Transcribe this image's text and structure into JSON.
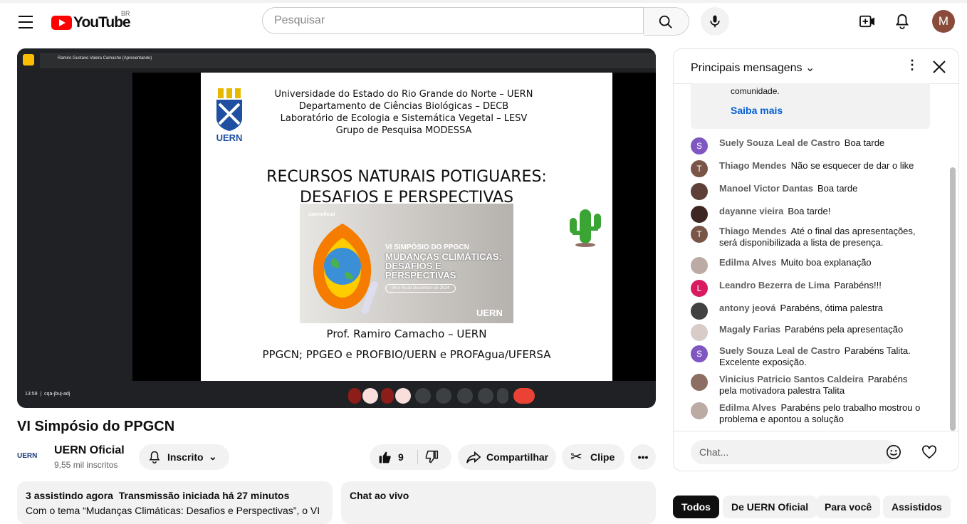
{
  "header": {
    "logo_text": "YouTube",
    "region": "BR",
    "search_placeholder": "Pesquisar",
    "avatar_letter": "M"
  },
  "player": {
    "meet_presenter": "Ramiro Gustavo Valera Camacho (Apresentando)",
    "clock": "13:59",
    "meeting_code": "cqa-jbuj-adj",
    "slide": {
      "header_lines": [
        "Universidade do Estado do Rio Grande do Norte – UERN",
        "Departamento de Ciências Biológicas – DECB",
        "Laboratório de Ecologia e Sistemática Vegetal – LESV",
        "Grupo de Pesquisa MODESSA"
      ],
      "logo_text": "UERN",
      "title_line1": "RECURSOS NATURAIS POTIGUARES:",
      "title_line2": "DESAFIOS E PERSPECTIVAS",
      "poster": {
        "handle": "/uernoficial",
        "event": "VI SIMPÓSIO DO PPGCN",
        "headline": "MUDANÇAS CLIMÁTICAS: DESAFIOS E PERSPECTIVAS",
        "dates": "04 e 05 de Dezembro de 2024",
        "brand": "UERN"
      },
      "presenter": "Prof. Ramiro Camacho – UERN",
      "programs": "PPGCN; PPGEO e PROFBIO/UERN e PROFAgua/UFERSA"
    }
  },
  "video": {
    "title": "VI Simpósio do PPGCN",
    "channel_logo": "UERN",
    "channel_name": "UERN Oficial",
    "subscribers": "9,55 mil inscritos",
    "subscribed_label": "Inscrito",
    "likes": "9",
    "share_label": "Compartilhar",
    "clip_label": "Clipe",
    "watching": "3",
    "watching_label": "assistindo agora",
    "started": "Transmissão iniciada há 27 minutos",
    "desc_preview": "Com o tema “Mudanças Climáticas: Desafios e Perspectivas”, o VI",
    "chat_replay_label": "Chat ao vivo"
  },
  "chat": {
    "header": "Principais mensagens",
    "notice_text": "comunidade.",
    "notice_link": "Saiba mais",
    "input_placeholder": "Chat...",
    "messages": [
      {
        "initial": "S",
        "name": "Suely Souza Leal de Castro",
        "text": "Boa tarde",
        "color": "#7e57c2"
      },
      {
        "initial": "T",
        "name": "Thiago Mendes",
        "text": "Não se esquecer de dar o like",
        "color": "#795548"
      },
      {
        "initial": "",
        "name": "Manoel Victor Dantas",
        "text": "Boa tarde",
        "color": "#5d4037"
      },
      {
        "initial": "",
        "name": "dayanne vieira",
        "text": "Boa tarde!",
        "color": "#3e2723"
      },
      {
        "initial": "T",
        "name": "Thiago Mendes",
        "text": "Até o final das apresentações, será disponibilizada a lista de presença.",
        "color": "#795548"
      },
      {
        "initial": "",
        "name": "Edilma Alves",
        "text": "Muito boa explanação",
        "color": "#bcaaa4"
      },
      {
        "initial": "L",
        "name": "Leandro Bezerra de Lima",
        "text": "Parabéns!!!",
        "color": "#d81b60"
      },
      {
        "initial": "",
        "name": "antony jeová",
        "text": "Parabéns, ótima palestra",
        "color": "#424242"
      },
      {
        "initial": "",
        "name": "Magaly Farias",
        "text": "Parabéns pela apresentação",
        "color": "#d7ccc8"
      },
      {
        "initial": "S",
        "name": "Suely Souza Leal de Castro",
        "text": "Parabéns Talita. Excelente exposição.",
        "color": "#7e57c2"
      },
      {
        "initial": "",
        "name": "Vinicius Patricio Santos Caldeira",
        "text": "Parabéns pela motivadora palestra Talita",
        "color": "#8d6e63"
      },
      {
        "initial": "",
        "name": "Edilma Alves",
        "text": "Parabéns pelo trabalho mostrou o problema e apontou a solução",
        "color": "#bcaaa4"
      }
    ]
  },
  "chips": [
    "Todos",
    "De UERN Oficial",
    "Para você",
    "Assistidos"
  ]
}
